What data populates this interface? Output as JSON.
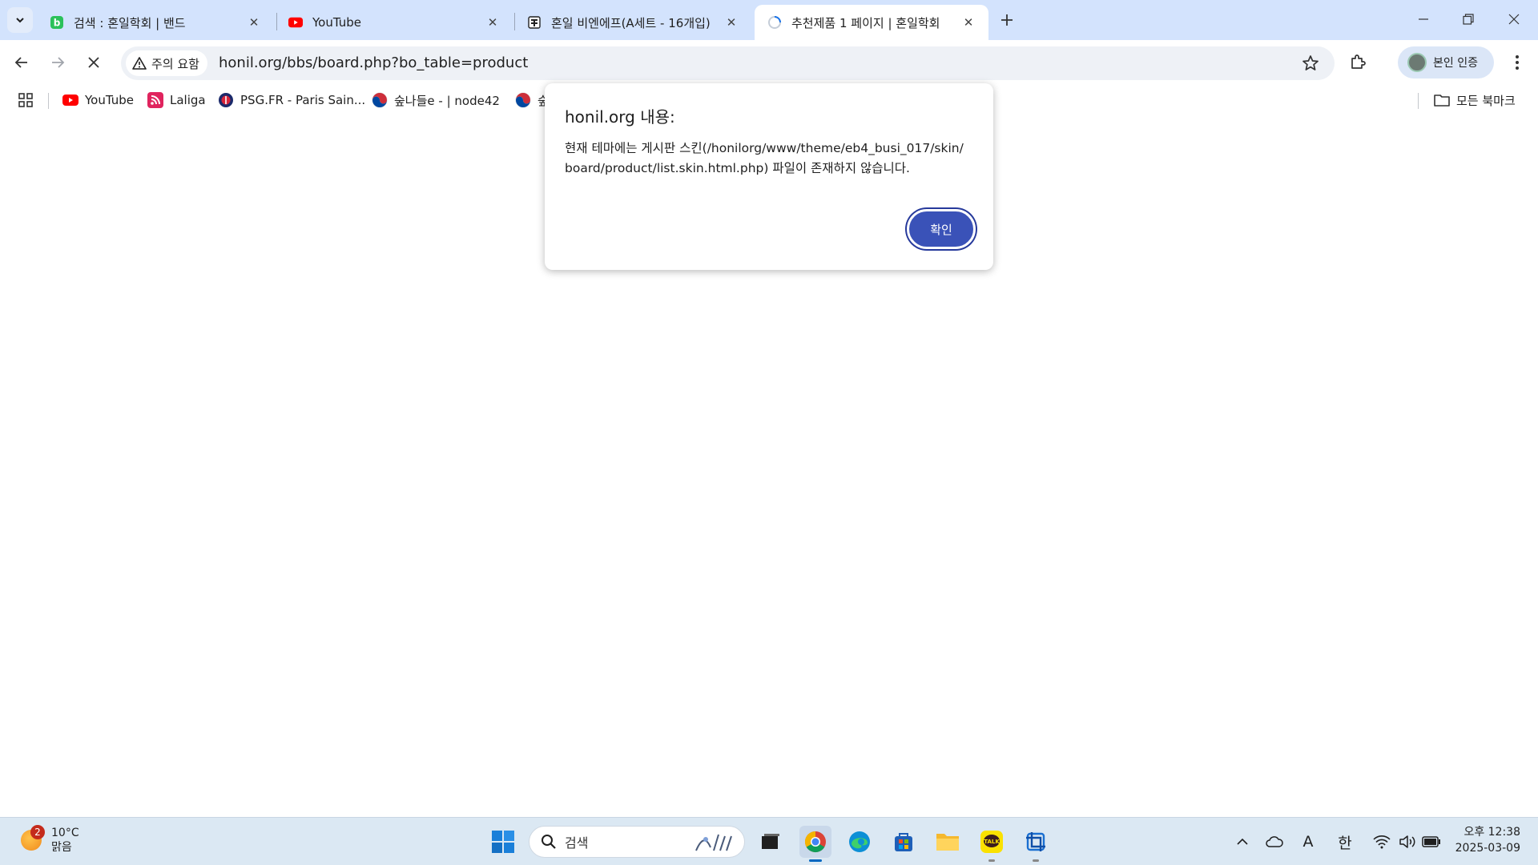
{
  "browser": {
    "tabs": [
      {
        "title": "검색 : 혼일학회 | 밴드",
        "active": false
      },
      {
        "title": "YouTube",
        "active": false
      },
      {
        "title": "혼일 비엔에프(A세트 - 16개입)",
        "active": false
      },
      {
        "title": "추천제품 1 페이지 | 혼일학회",
        "active": true
      }
    ],
    "security_chip": "주의 요함",
    "url": "honil.org/bbs/board.php?bo_table=product",
    "profile_label": "본인 인증",
    "bookmarks": [
      {
        "label": "YouTube"
      },
      {
        "label": "Laliga"
      },
      {
        "label": "PSG.FR - Paris Sain..."
      },
      {
        "label": "숲나들e - | node42"
      },
      {
        "label": "숲"
      }
    ],
    "all_bookmarks": "모든 북마크"
  },
  "dialog": {
    "title": "honil.org 내용:",
    "message": "현재 테마에는 게시판 스킨(/honilorg/www/theme/eb4_busi_017/skin/board/product/list.skin.html.php) 파일이 존재하지 않습니다.",
    "ok_label": "확인"
  },
  "taskbar": {
    "weather_badge": "2",
    "temperature": "10°C",
    "condition": "맑음",
    "search_placeholder": "검색",
    "ime_mode": "A",
    "ime_lang": "한",
    "time": "오후 12:38",
    "date": "2025-03-09"
  },
  "colors": {
    "tabstrip": "#d3e3fd",
    "dialog_button": "#3a52b8"
  }
}
